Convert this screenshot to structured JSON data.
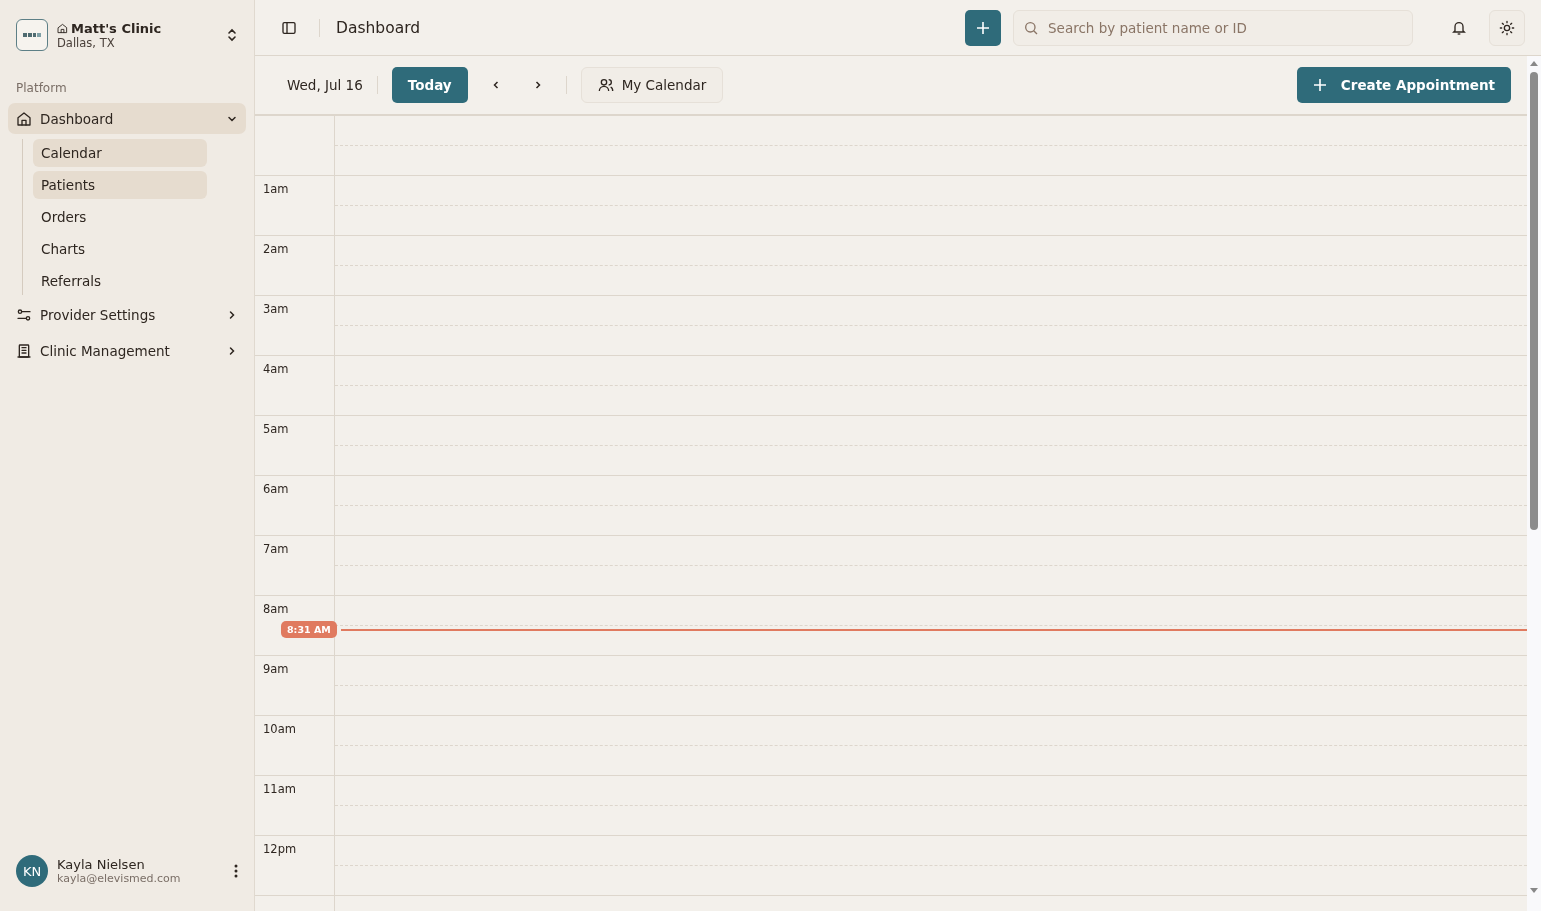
{
  "clinic": {
    "name": "Matt's Clinic",
    "location": "Dallas, TX"
  },
  "sidebar": {
    "section": "Platform",
    "items": [
      {
        "label": "Dashboard",
        "selected": true,
        "expanded": true,
        "children": [
          {
            "label": "Calendar",
            "selected": true
          },
          {
            "label": "Patients",
            "selected": true
          },
          {
            "label": "Orders",
            "selected": false
          },
          {
            "label": "Charts",
            "selected": false
          },
          {
            "label": "Referrals",
            "selected": false
          }
        ]
      },
      {
        "label": "Provider Settings",
        "selected": false,
        "expanded": false
      },
      {
        "label": "Clinic Management",
        "selected": false,
        "expanded": false
      }
    ]
  },
  "user": {
    "initials": "KN",
    "name": "Kayla Nielsen",
    "email": "kayla@elevismed.com"
  },
  "header": {
    "title": "Dashboard",
    "search": {
      "placeholder": "Search by patient name or ID"
    }
  },
  "toolbar": {
    "date": "Wed, Jul 16",
    "today": "Today",
    "calendar": "My Calendar",
    "create": "Create Appointment"
  },
  "hours": [
    {
      "label": "1am"
    },
    {
      "label": "2am"
    },
    {
      "label": "3am"
    },
    {
      "label": "4am"
    },
    {
      "label": "5am"
    },
    {
      "label": "6am"
    },
    {
      "label": "7am"
    },
    {
      "label": "8am",
      "now": "8:31 AM"
    },
    {
      "label": "9am"
    },
    {
      "label": "10am"
    },
    {
      "label": "11am"
    },
    {
      "label": "12pm"
    }
  ]
}
